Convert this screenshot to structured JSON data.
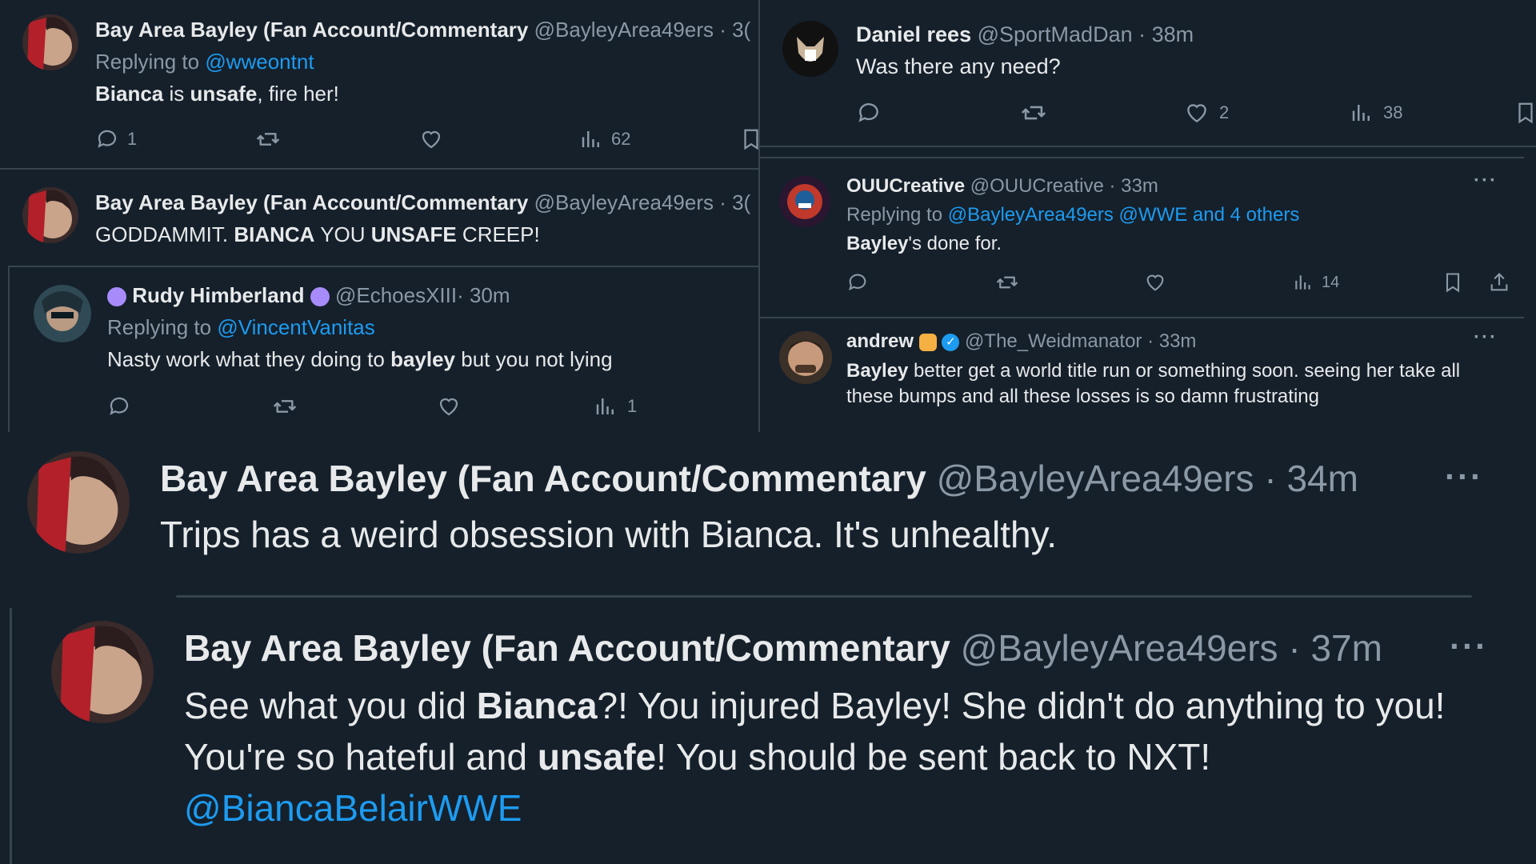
{
  "colors": {
    "background": "#15202b",
    "text": "#e7e9ea",
    "muted": "#8b98a5",
    "link": "#1d9bf0",
    "divider": "#38444d"
  },
  "tweets": {
    "t1": {
      "name": "Bay Area Bayley (Fan Account/Commentary",
      "handle": "@BayleyArea49ers",
      "time": "· 3(",
      "reply_label": "Replying to",
      "reply_to": "@wweontnt",
      "text_b1": "Bianca",
      "text_r1": " is ",
      "text_b2": "unsafe",
      "text_r2": ", fire her!",
      "replies": "1",
      "views": "62"
    },
    "t2": {
      "name": "Bay Area Bayley (Fan Account/Commentary",
      "handle": "@BayleyArea49ers",
      "time": "· 3(",
      "text_r1": "GODDAMMIT. ",
      "text_b1": "BIANCA",
      "text_r2": " YOU ",
      "text_b2": "UNSAFE",
      "text_r3": " CREEP!"
    },
    "t3": {
      "name": "Rudy Himberland",
      "handle": "@EchoesXIII",
      "time": "· 30m",
      "reply_label": "Replying to",
      "reply_to": "@VincentVanitas",
      "text_r1": "Nasty work what they doing to ",
      "text_b1": "bayley",
      "text_r2": " but you not lying",
      "views": "1"
    },
    "t4": {
      "name": "Daniel rees",
      "handle": "@SportMadDan",
      "time": "· 38m",
      "text": "Was there any need?",
      "likes": "2",
      "views": "38"
    },
    "t5": {
      "name": "OUUCreative",
      "handle": "@OUUCreative",
      "time": "· 33m",
      "reply_label": "Replying to",
      "reply_to": "@BayleyArea49ers @WWE and 4 others",
      "text_b1": "Bayley",
      "text_r1": "'s done for.",
      "views": "14"
    },
    "t6": {
      "name": "andrew",
      "handle": "@The_Weidmanator",
      "time": "· 33m",
      "text_b1": "Bayley",
      "text_r1": " better get a world title run or something soon. seeing her take all these bumps and all these losses is so damn frustrating"
    },
    "t7": {
      "name": "Bay Area Bayley (Fan Account/Commentary",
      "handle": "@BayleyArea49ers",
      "time": "· 34m",
      "text": "Trips has a weird obsession with Bianca. It's unhealthy."
    },
    "t8": {
      "name": "Bay Area Bayley (Fan Account/Commentary",
      "handle": "@BayleyArea49ers",
      "time": "· 37m",
      "text_r1": "See what you did ",
      "text_b1": "Bianca",
      "text_r2": "?! You injured Bayley! She didn't do anything to you! You're so hateful and ",
      "text_b2": "unsafe",
      "text_r3": "! You should be sent back to NXT!",
      "mention": "@BiancaBelairWWE"
    }
  }
}
